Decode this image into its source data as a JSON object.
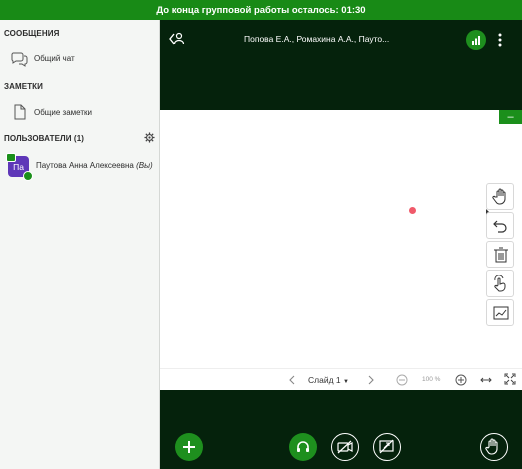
{
  "banner": {
    "text": "До конца групповой работы осталось: 01:30"
  },
  "sidebar": {
    "messages_title": "СООБЩЕНИЯ",
    "public_chat": "Общий чат",
    "notes_title": "ЗАМЕТКИ",
    "shared_notes": "Общие заметки",
    "users_title": "ПОЛЬЗОВАТЕЛИ (1)",
    "users": [
      {
        "initials": "Па",
        "name": "Паутова Анна Алексеевна",
        "suffix": "(Вы)"
      }
    ]
  },
  "main": {
    "participants": "Попова Е.А., Ромахина А.А., Пауто...",
    "minimize_label": "–",
    "slide_label": "Слайд 1",
    "zoom": "100 %"
  },
  "icons": {
    "back": "back-user-icon",
    "signal": "signal-bars-icon",
    "more": "more-vert-icon",
    "tools": [
      "hand-icon",
      "undo-icon",
      "trash-icon",
      "multi-user-hand-icon",
      "chart-icon"
    ],
    "bottom": [
      "plus-icon",
      "headphones-icon",
      "video-off-icon",
      "screen-share-off-icon",
      "raise-hand-icon"
    ]
  },
  "colors": {
    "brand": "#188a16",
    "dark": "#05220c",
    "avatar": "#5e37b8",
    "dot": "#f05a6a"
  }
}
